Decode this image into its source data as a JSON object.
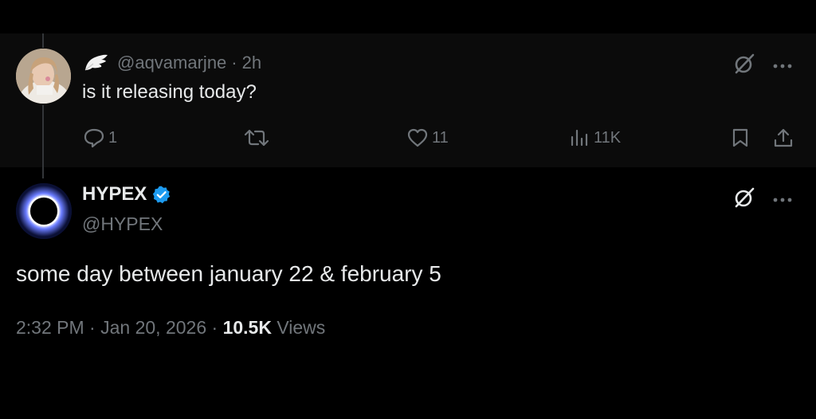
{
  "reply": {
    "handle": "@aqvamarjne",
    "separator": "·",
    "time": "2h",
    "text": "is it releasing today?",
    "actions": {
      "replies": "1",
      "retweets": "",
      "likes": "11",
      "views": "11K"
    }
  },
  "tweet": {
    "name": "HYPEX",
    "handle": "@HYPEX",
    "text": "some day between january 22 & february 5",
    "time": "2:32 PM",
    "date": "Jan 20, 2026",
    "separator": "·",
    "views_count": "10.5K",
    "views_label": "Views"
  },
  "colors": {
    "background": "#000000",
    "reply_background": "#0b0b0b",
    "text": "#e7e9ea",
    "muted": "#71767b",
    "verified": "#1d9bf0"
  },
  "icons": [
    "wing-emoji",
    "reply-icon",
    "retweet-icon",
    "like-icon",
    "views-icon",
    "bookmark-icon",
    "share-icon",
    "grok-icon",
    "more-icon",
    "verified-badge-icon"
  ]
}
